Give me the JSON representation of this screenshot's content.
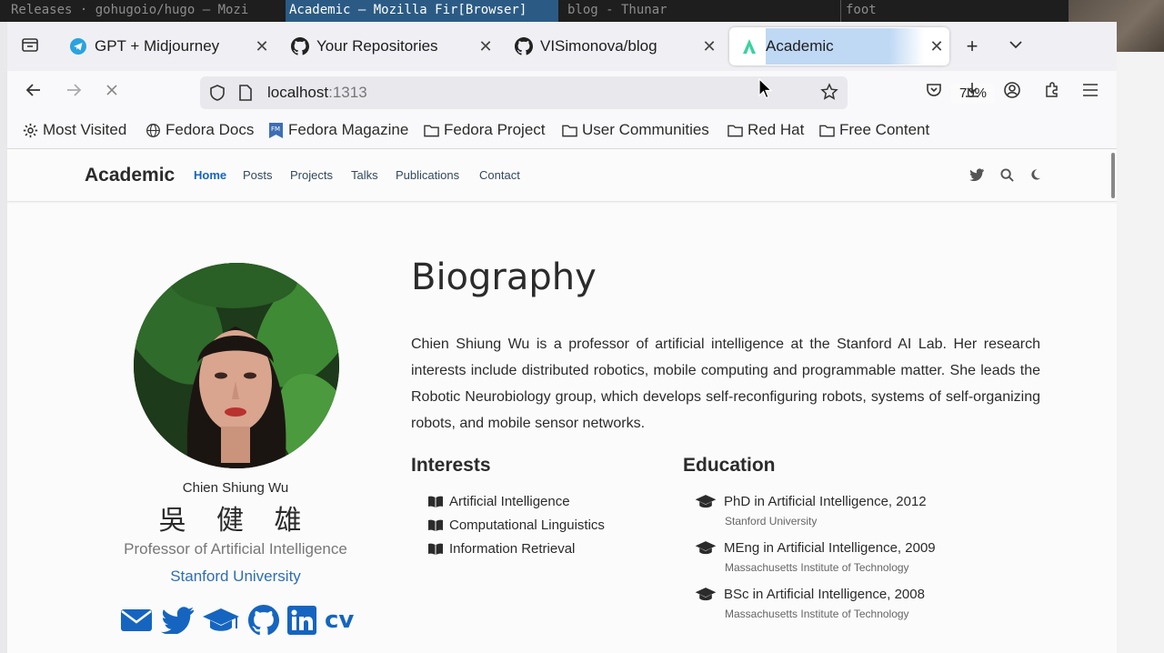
{
  "wm": {
    "seg1": "Releases · gohugoio/hugo — Mozi",
    "seg2": "Academic — Mozilla Fir[Browser]",
    "seg3": "blog - Thunar",
    "seg4": "foot"
  },
  "tabs": [
    {
      "label": "GPT + Midjourney",
      "icon": "telegram-icon"
    },
    {
      "label": "Your Repositories",
      "icon": "github-icon"
    },
    {
      "label": "VISimonova/blog",
      "icon": "github-icon"
    },
    {
      "label": "Academic",
      "icon": "academic-icon",
      "active": true
    }
  ],
  "nav": {
    "url_host": "localhost",
    "url_port": ":1313",
    "zoom": "70%"
  },
  "bookmarks": [
    {
      "label": "Most Visited",
      "icon": "gear-icon"
    },
    {
      "label": "Fedora Docs",
      "icon": "globe-icon"
    },
    {
      "label": "Fedora Magazine",
      "icon": "fedora-magazine-icon"
    },
    {
      "label": "Fedora Project",
      "icon": "folder-icon"
    },
    {
      "label": "User Communities",
      "icon": "folder-icon"
    },
    {
      "label": "Red Hat",
      "icon": "folder-icon"
    },
    {
      "label": "Free Content",
      "icon": "folder-icon"
    }
  ],
  "site": {
    "brand": "Academic",
    "menu": [
      "Home",
      "Posts",
      "Projects",
      "Talks",
      "Publications",
      "Contact"
    ]
  },
  "profile": {
    "name": "Chien Shiung Wu",
    "name_cn": "吳 健 雄",
    "role": "Professor of Artificial Intelligence",
    "org": "Stanford University",
    "cv": "CV"
  },
  "bio": {
    "title": "Biography",
    "text": "Chien Shiung Wu is a professor of artificial intelligence at the Stanford AI Lab. Her research interests include distributed robotics, mobile computing and programmable matter. She leads the Robotic Neurobiology group, which develops self-reconfiguring robots, systems of self-organizing robots, and mobile sensor networks."
  },
  "interests": {
    "title": "Interests",
    "items": [
      "Artificial Intelligence",
      "Computational Linguistics",
      "Information Retrieval"
    ]
  },
  "education": {
    "title": "Education",
    "items": [
      {
        "degree": "PhD in Artificial Intelligence, 2012",
        "institution": "Stanford University"
      },
      {
        "degree": "MEng in Artificial Intelligence, 2009",
        "institution": "Massachusetts Institute of Technology"
      },
      {
        "degree": "BSc in Artificial Intelligence, 2008",
        "institution": "Massachusetts Institute of Technology"
      }
    ]
  },
  "colors": {
    "accent": "#1565c0",
    "active_tab_highlight": "#b8d4f3",
    "wm_active": "#2b5b84"
  }
}
